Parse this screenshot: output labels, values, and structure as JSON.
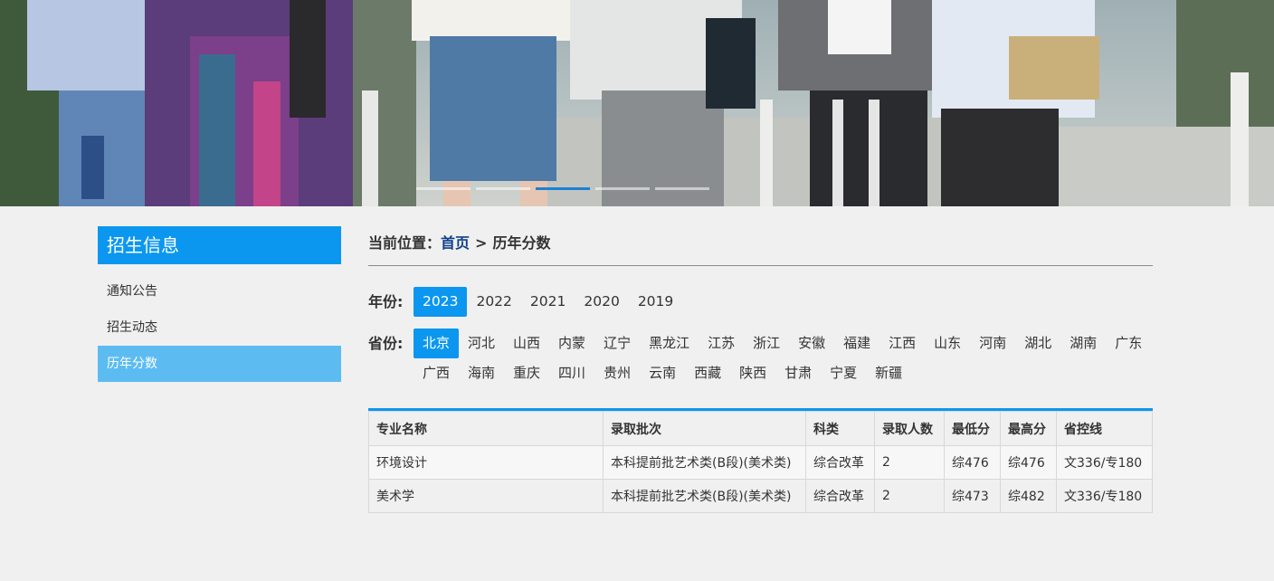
{
  "banner": {
    "active_slide": 3,
    "slide_count": 5
  },
  "sidebar": {
    "title": "招生信息",
    "items": [
      {
        "label": "通知公告",
        "active": false
      },
      {
        "label": "招生动态",
        "active": false
      },
      {
        "label": "历年分数",
        "active": true
      }
    ]
  },
  "breadcrumb": {
    "prefix": "当前位置：",
    "home": "首页",
    "separator": ">",
    "current": "历年分数"
  },
  "filters": {
    "year_label": "年份:",
    "years": [
      "2023",
      "2022",
      "2021",
      "2020",
      "2019"
    ],
    "selected_year": "2023",
    "province_label": "省份:",
    "provinces": [
      "北京",
      "河北",
      "山西",
      "内蒙",
      "辽宁",
      "黑龙江",
      "江苏",
      "浙江",
      "安徽",
      "福建",
      "江西",
      "山东",
      "河南",
      "湖北",
      "湖南",
      "广东",
      "广西",
      "海南",
      "重庆",
      "四川",
      "贵州",
      "云南",
      "西藏",
      "陕西",
      "甘肃",
      "宁夏",
      "新疆"
    ],
    "selected_province": "北京"
  },
  "table": {
    "headers": [
      "专业名称",
      "录取批次",
      "科类",
      "录取人数",
      "最低分",
      "最高分",
      "省控线"
    ],
    "rows": [
      [
        "环境设计",
        "本科提前批艺术类(B段)(美术类)",
        "综合改革",
        "2",
        "综476",
        "综476",
        "文336/专180"
      ],
      [
        "美术学",
        "本科提前批艺术类(B段)(美术类)",
        "综合改革",
        "2",
        "综473",
        "综482",
        "文336/专180"
      ]
    ]
  },
  "colors": {
    "accent": "#0b97ef",
    "sidebar_active": "#5cbcf2",
    "breadcrumb_home": "#0f3f8a",
    "background": "#f0f0f0"
  }
}
